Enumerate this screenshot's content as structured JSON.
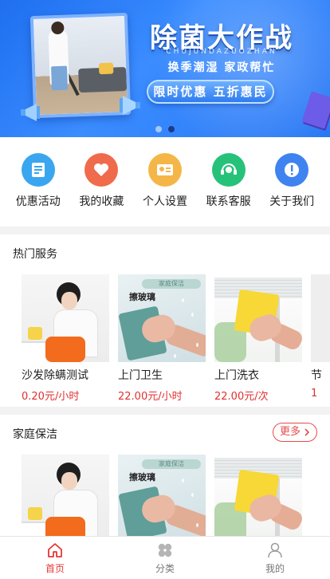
{
  "banner": {
    "title": "除菌大作战",
    "pinyin": "CHUJUNDAZUOZHAN",
    "tagline": "换季潮湿 家政帮忙",
    "promo": "限时优惠 五折惠民",
    "slide_count": 2,
    "active_slide": 2
  },
  "quick_links": [
    {
      "label": "优惠活动",
      "icon": "coupon-icon",
      "color": "#3aa6f0"
    },
    {
      "label": "我的收藏",
      "icon": "heart-icon",
      "color": "#ef6b4c"
    },
    {
      "label": "个人设置",
      "icon": "profile-card-icon",
      "color": "#f5b648"
    },
    {
      "label": "联系客服",
      "icon": "headset-icon",
      "color": "#27c27a"
    },
    {
      "label": "关于我们",
      "icon": "info-icon",
      "color": "#3f83f0"
    }
  ],
  "hot_services": {
    "title": "热门服务",
    "items": [
      {
        "name": "沙发除螨测试",
        "price": "0.20元/小时"
      },
      {
        "name": "上门卫生",
        "price": "22.00元/小时"
      },
      {
        "name": "上门洗衣",
        "price": "22.00元/次"
      },
      {
        "name": "节",
        "price": "1"
      }
    ],
    "thumb_texts": {
      "badge": "家庭保洁",
      "label": "擦玻璃"
    }
  },
  "home_cleaning": {
    "title": "家庭保洁",
    "more_label": "更多"
  },
  "tabbar": [
    {
      "label": "首页",
      "icon": "home-icon",
      "active": true
    },
    {
      "label": "分类",
      "icon": "category-icon",
      "active": false
    },
    {
      "label": "我的",
      "icon": "user-icon",
      "active": false
    }
  ],
  "colors": {
    "accent": "#e53935",
    "price": "#e03030",
    "banner": "#2a78f5"
  }
}
